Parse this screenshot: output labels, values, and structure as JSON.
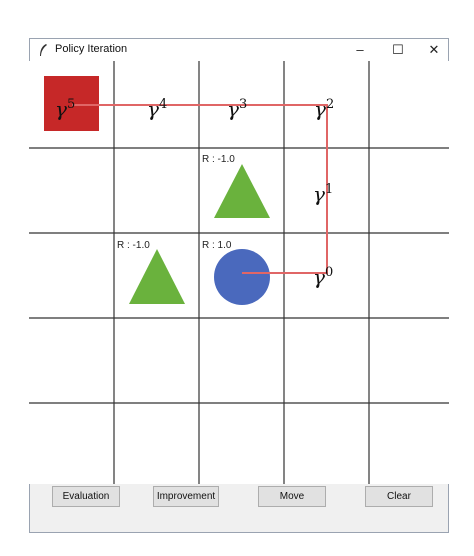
{
  "window": {
    "title": "Policy Iteration",
    "icon": "feather-icon",
    "controls": {
      "minimize": "–",
      "maximize": "☐",
      "close": "✕"
    }
  },
  "grid": {
    "rows": 5,
    "cols": 5,
    "line_color": "#333333",
    "path_color": "#e06666"
  },
  "agent": {
    "color": "#c62828",
    "label_base": "γ",
    "label_exp": "5"
  },
  "discount_labels": [
    {
      "base": "γ",
      "exp": "4"
    },
    {
      "base": "γ",
      "exp": "3"
    },
    {
      "base": "γ",
      "exp": "2"
    },
    {
      "base": "γ",
      "exp": "1"
    },
    {
      "base": "γ",
      "exp": "0"
    }
  ],
  "obstacles": [
    {
      "reward": "R : -1.0",
      "color": "#6ab23d"
    },
    {
      "reward": "R : -1.0",
      "color": "#6ab23d"
    }
  ],
  "goal": {
    "reward": "R : 1.0",
    "color": "#4a69bd"
  },
  "buttons": {
    "evaluation": "Evaluation",
    "improvement": "Improvement",
    "move": "Move",
    "clear": "Clear"
  }
}
